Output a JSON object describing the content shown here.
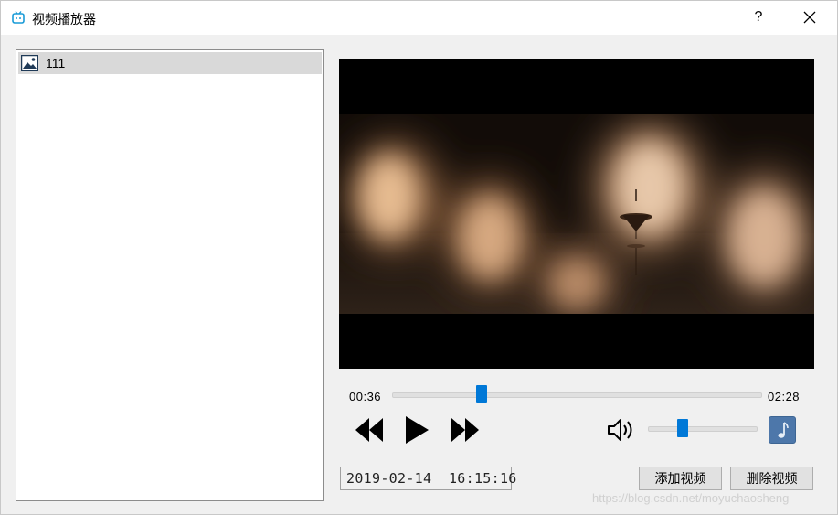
{
  "window": {
    "title": "视频播放器",
    "help_label": "?"
  },
  "playlist": {
    "items": [
      {
        "label": "111",
        "icon": "image-icon",
        "selected": true
      }
    ]
  },
  "player": {
    "current_time": "00:36",
    "total_time": "02:28",
    "progress_fraction": 0.243,
    "volume_fraction": 0.32,
    "controls": {
      "rewind": "rewind-icon",
      "play": "play-icon",
      "forward": "fast-forward-icon",
      "volume": "speaker-icon",
      "music": "music-note-icon"
    }
  },
  "footer": {
    "datetime": "2019-02-14  16:15:16",
    "add_video_label": "添加视频",
    "delete_video_label": "删除视频"
  },
  "watermark": "https://blog.csdn.net/moyuchaosheng",
  "colors": {
    "accent": "#0078d7",
    "music_button": "#4d77aa",
    "selection": "#d9d9d9"
  }
}
